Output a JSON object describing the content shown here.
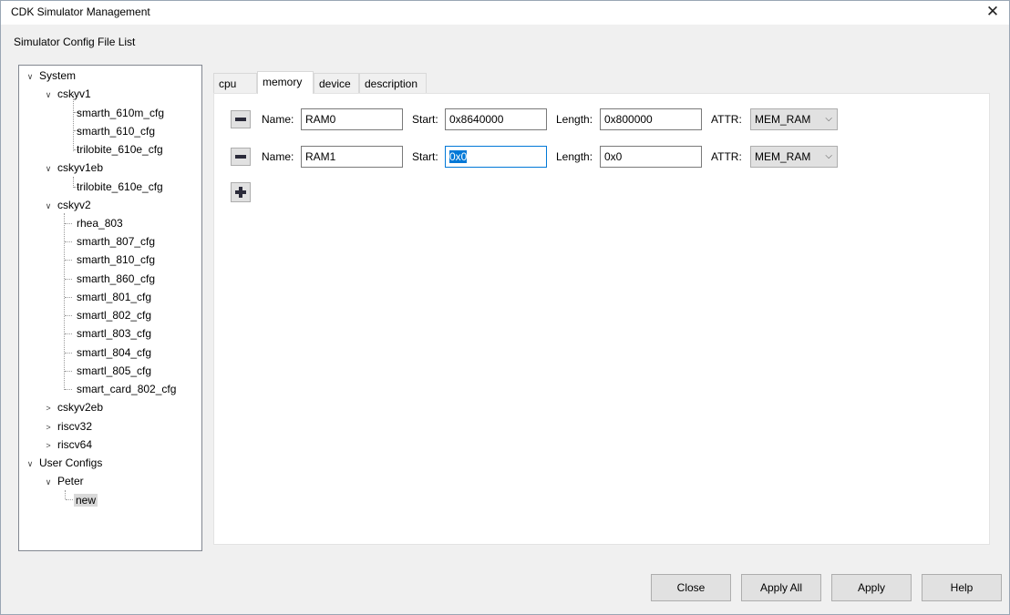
{
  "window": {
    "title": "CDK Simulator Management",
    "close_glyph": "✕"
  },
  "group_label": "Simulator Config File List",
  "tree": {
    "items": [
      {
        "label": "System",
        "expander": "expanded"
      },
      {
        "label": "cskyv1",
        "expander": "expanded"
      },
      {
        "label": "smarth_610m_cfg",
        "expander": "none"
      },
      {
        "label": "smarth_610_cfg",
        "expander": "none"
      },
      {
        "label": "trilobite_610e_cfg",
        "expander": "none"
      },
      {
        "label": "cskyv1eb",
        "expander": "expanded"
      },
      {
        "label": "trilobite_610e_cfg",
        "expander": "none"
      },
      {
        "label": "cskyv2",
        "expander": "expanded"
      },
      {
        "label": "rhea_803",
        "expander": "none"
      },
      {
        "label": "smarth_807_cfg",
        "expander": "none"
      },
      {
        "label": "smarth_810_cfg",
        "expander": "none"
      },
      {
        "label": "smarth_860_cfg",
        "expander": "none"
      },
      {
        "label": "smartl_801_cfg",
        "expander": "none"
      },
      {
        "label": "smartl_802_cfg",
        "expander": "none"
      },
      {
        "label": "smartl_803_cfg",
        "expander": "none"
      },
      {
        "label": "smartl_804_cfg",
        "expander": "none"
      },
      {
        "label": "smartl_805_cfg",
        "expander": "none"
      },
      {
        "label": "smart_card_802_cfg",
        "expander": "none"
      },
      {
        "label": "cskyv2eb",
        "expander": "collapsed"
      },
      {
        "label": "riscv32",
        "expander": "collapsed"
      },
      {
        "label": "riscv64",
        "expander": "collapsed"
      },
      {
        "label": "User Configs",
        "expander": "expanded"
      },
      {
        "label": "Peter",
        "expander": "expanded"
      },
      {
        "label": "new",
        "expander": "none",
        "selected": true
      }
    ]
  },
  "tabs": [
    {
      "label": "cpu",
      "active": false
    },
    {
      "label": "memory",
      "active": true
    },
    {
      "label": "device",
      "active": false
    },
    {
      "label": "description",
      "active": false
    }
  ],
  "memory": {
    "name_label": "Name:",
    "start_label": "Start:",
    "length_label": "Length:",
    "attr_label": "ATTR:",
    "rows": [
      {
        "name": "RAM0",
        "start": "0x8640000",
        "length": "0x800000",
        "attr": "MEM_RAM"
      },
      {
        "name": "RAM1",
        "start": "0x0",
        "length": "0x0",
        "attr": "MEM_RAM"
      }
    ],
    "chev_glyph": "⌵"
  },
  "buttons": {
    "close": "Close",
    "apply_all": "Apply All",
    "apply": "Apply",
    "help": "Help"
  }
}
